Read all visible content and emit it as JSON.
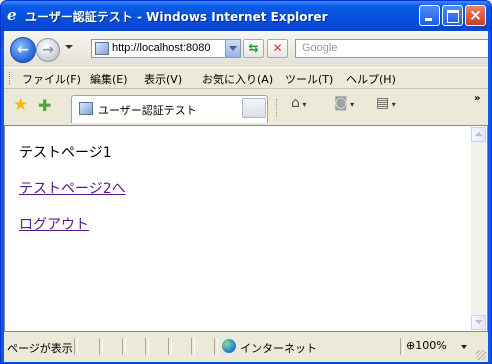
{
  "window": {
    "title": "ユーザー認証テスト - Windows Internet Explorer",
    "icon": "ie-icon",
    "controls": [
      "minimize",
      "maximize",
      "close"
    ]
  },
  "toolbar": {
    "back_icon": "back-arrow-icon",
    "forward_icon": "forward-arrow-icon",
    "address": "http://localhost:8080",
    "search_placeholder": "Google"
  },
  "menu": {
    "items": [
      "ファイル(F)",
      "編集(E)",
      "表示(V)",
      "お気に入り(A)",
      "ツール(T)",
      "ヘルプ(H)"
    ]
  },
  "tabs": {
    "active_title": "ユーザー認証テスト"
  },
  "page": {
    "heading": "テストページ1",
    "links": [
      "テストページ2へ",
      "ログアウト"
    ],
    "link_color": "#551a8b"
  },
  "status": {
    "text": "ページが表示",
    "zone": "インターネット",
    "zoom": "100%"
  },
  "colors": {
    "titlebar": "#0a5ae8",
    "chrome": "#ece9d8"
  }
}
